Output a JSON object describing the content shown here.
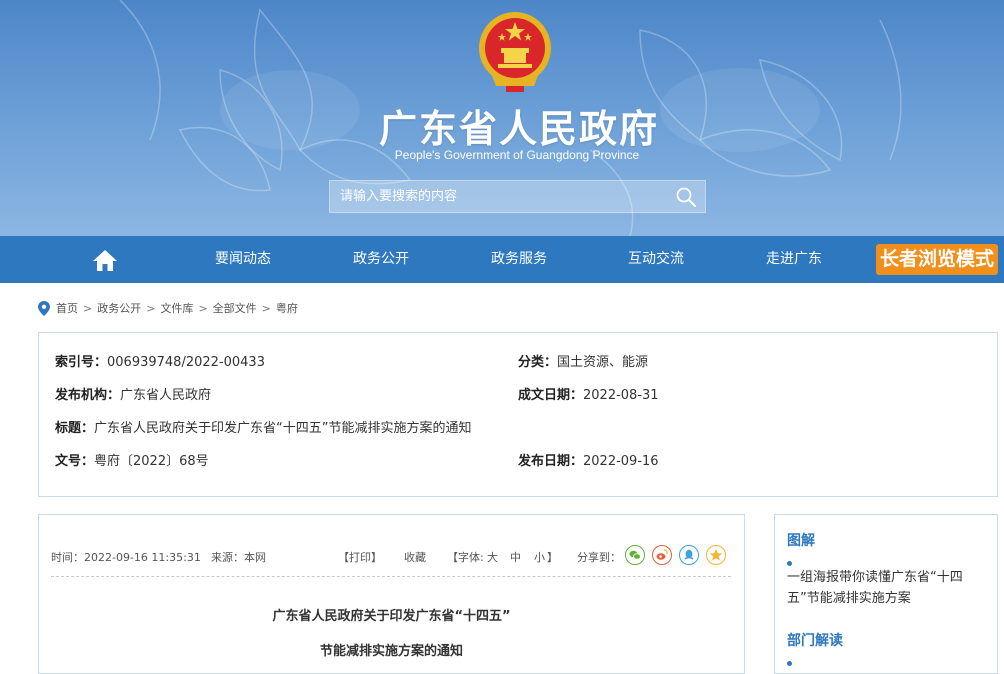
{
  "header": {
    "title": "广东省人民政府",
    "subtitle": "People's Government of Guangdong Province",
    "search_placeholder": "请输入要搜索的内容"
  },
  "nav": {
    "items": [
      "要闻动态",
      "政务公开",
      "政务服务",
      "互动交流",
      "走进广东"
    ],
    "elder_mode": "长者浏览模式"
  },
  "breadcrumb": [
    "首页",
    "政务公开",
    "文件库",
    "全部文件",
    "粤府"
  ],
  "meta": {
    "index_label": "索引号：",
    "index_value": "006939748/2022-00433",
    "category_label": "分类：",
    "category_value": "国土资源、能源",
    "issuer_label": "发布机构：",
    "issuer_value": "广东省人民政府",
    "written_label": "成文日期：",
    "written_value": "2022-08-31",
    "title_label": "标题：",
    "title_value": "广东省人民政府关于印发广东省“十四五”节能减排实施方案的通知",
    "docno_label": "文号：",
    "docno_value": "粤府〔2022〕68号",
    "published_label": "发布日期：",
    "published_value": "2022-09-16"
  },
  "article": {
    "time": "时间：2022-09-16 11:35:31",
    "source": "来源：本网",
    "print": "【打印】",
    "favorite": "收藏",
    "font_label": "【字体:",
    "font_large": "大",
    "font_medium": "中",
    "font_small": "小",
    "font_close": "】",
    "share": "分享到：",
    "title_line1": "广东省人民政府关于印发广东省“十四五”",
    "title_line2": "节能减排实施方案的通知"
  },
  "sidebar": {
    "heading1": "图解",
    "link1": "一组海报带你读懂广东省“十四五”节能减排实施方案",
    "heading2": "部门解读"
  },
  "colors": {
    "nav_blue": "#2e78bf",
    "elder_orange": "#f08f1c",
    "wechat": "#5fb236",
    "weibo": "#e0613b",
    "qq": "#3aa3e3",
    "qzone": "#f2b631"
  }
}
